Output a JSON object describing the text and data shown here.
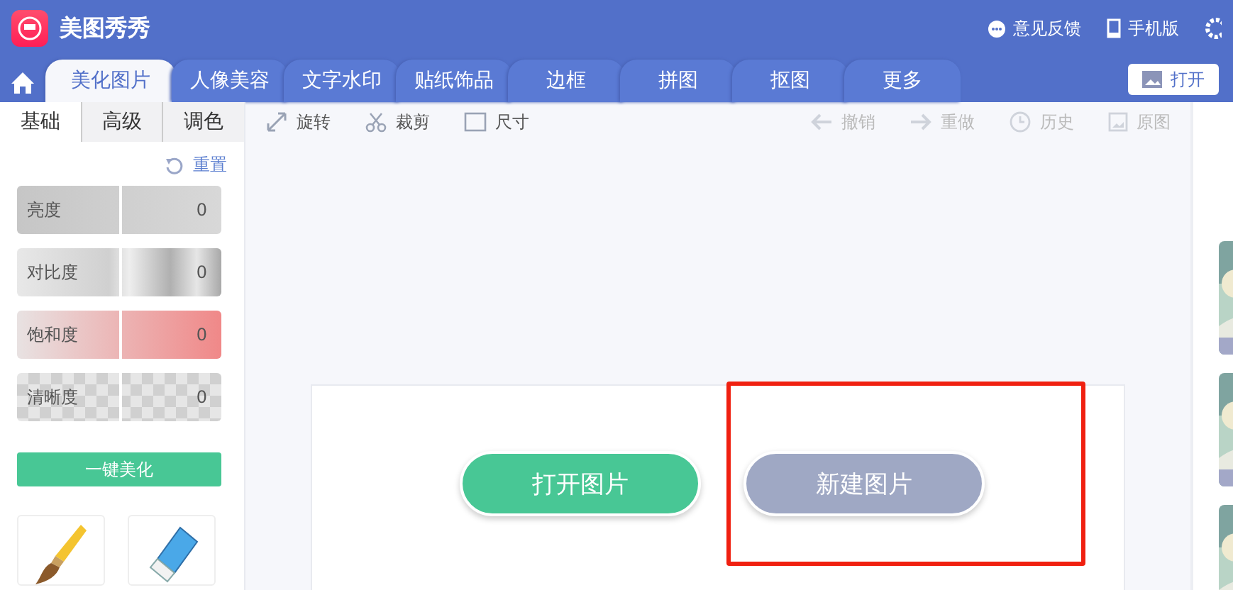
{
  "app": {
    "title": "美图秀秀",
    "links": [
      "意见反馈",
      "手机版"
    ]
  },
  "tabs": [
    {
      "label": "美化图片",
      "selected": true
    },
    {
      "label": "人像美容",
      "selected": false
    },
    {
      "label": "文字水印",
      "selected": false
    },
    {
      "label": "贴纸饰品",
      "selected": false
    },
    {
      "label": "边框",
      "selected": false
    },
    {
      "label": "拼图",
      "selected": false
    },
    {
      "label": "抠图",
      "selected": false
    },
    {
      "label": "更多",
      "selected": false
    }
  ],
  "open_button": "打开",
  "panel": {
    "tabs": [
      {
        "label": "基础",
        "selected": true
      },
      {
        "label": "高级",
        "selected": false
      },
      {
        "label": "调色",
        "selected": false
      }
    ],
    "reset": "重置",
    "sliders": [
      {
        "kind": "brightness",
        "label": "亮度",
        "value": "0",
        "level": 0.5
      },
      {
        "kind": "contrast",
        "label": "对比度",
        "value": "0",
        "level": 0.5
      },
      {
        "kind": "saturation",
        "label": "饱和度",
        "value": "0",
        "level": 0.5
      },
      {
        "kind": "sharpness",
        "label": "清晰度",
        "value": "0",
        "level": 0.5
      }
    ],
    "auto_button": "一键美化",
    "tools": [
      {
        "kind": "brush"
      },
      {
        "kind": "eraser"
      }
    ]
  },
  "toolbar": {
    "left": [
      {
        "kind": "rotate",
        "label": "旋转"
      },
      {
        "kind": "crop",
        "label": "裁剪"
      },
      {
        "kind": "size",
        "label": "尺寸"
      }
    ],
    "right": [
      {
        "kind": "undo",
        "label": "撤销",
        "disabled": true
      },
      {
        "kind": "redo",
        "label": "重做",
        "disabled": true
      },
      {
        "kind": "history",
        "label": "历史",
        "disabled": true
      },
      {
        "kind": "original",
        "label": "原图",
        "disabled": true
      }
    ]
  },
  "canvas": {
    "buttons": [
      {
        "kind": "primary",
        "label": "打开图片"
      },
      {
        "kind": "secondary",
        "label": "新建图片",
        "highlighted": true
      }
    ]
  }
}
